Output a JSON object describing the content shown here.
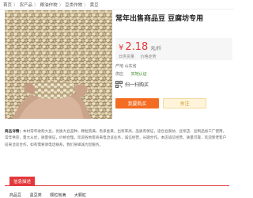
{
  "breadcrumb": [
    "首页",
    "农产品",
    "粮油作物",
    "豆类作物",
    "黄豆"
  ],
  "product": {
    "title": "常年出售商品豆 豆腐坊专用",
    "currency": "¥",
    "price": "2.18",
    "unit": "元/斤",
    "meta": [
      "日供货量",
      "价格走势"
    ],
    "origin_label": "产地 山东省",
    "seller_label": "供应",
    "seller_name": "实地认证",
    "qr_label": "扫一扫购买"
  },
  "buttons": {
    "buy": "我要购买",
    "follow": "关注"
  },
  "description": {
    "label": "商品详情：",
    "text": "本村常年收购大豆，优质大豆品种，颗粒饱满，色泽金黄，出浆率高，品质有保证，适合豆腐坊、豆浆店、豆制品加工厂使用，常年供货，量大从优，质量保证，价格合理，欢迎各地客商来电洽谈业务，诚信经营，长期合作。本店诚信经营，质量可靠，欢迎新老客户前来洽谈合作，如有需要请电话联系，我们将竭诚为您服务。"
  },
  "tabs": [
    "信息描述"
  ],
  "attributes": [
    "商品豆",
    "黑豆类",
    "颗粒饱满",
    "大颗粒"
  ],
  "colors": {
    "accent": "#e4393c",
    "buy_button": "#f36c21",
    "follow_button": "#fff4d9",
    "seller_green": "#3a8b1e"
  }
}
